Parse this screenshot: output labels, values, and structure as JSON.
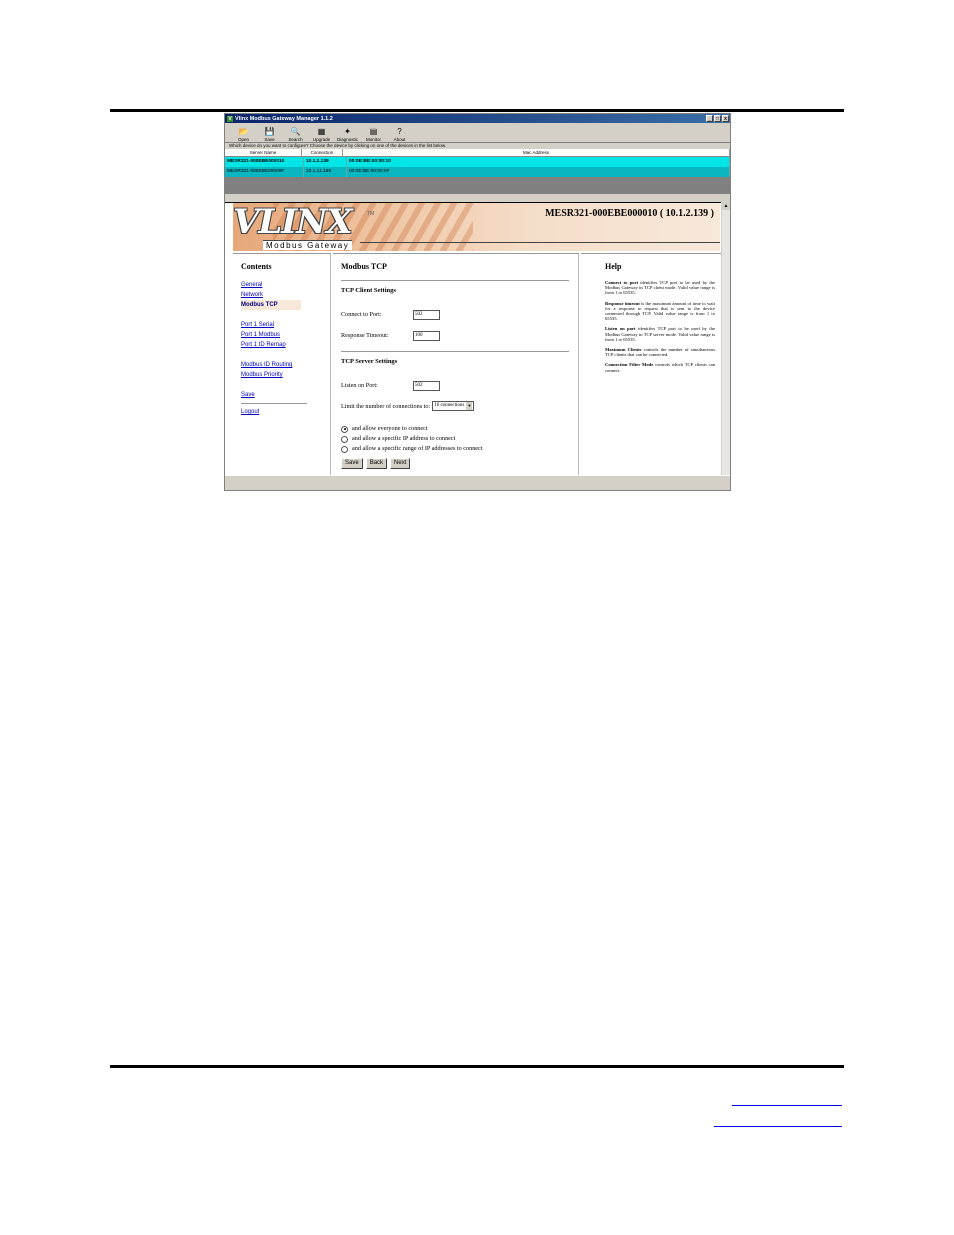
{
  "window": {
    "title": "Vlinx Modbus Gateway Manager 1.1.2",
    "controls": [
      "_",
      "□",
      "x"
    ]
  },
  "toolbar": [
    {
      "label": "Open",
      "icon": "open-folder-icon",
      "glyph": "📂"
    },
    {
      "label": "Save",
      "icon": "save-disk-icon",
      "glyph": "💾"
    },
    {
      "label": "Search",
      "icon": "search-icon",
      "glyph": "🔍"
    },
    {
      "label": "Upgrade",
      "icon": "upgrade-icon",
      "glyph": "▦"
    },
    {
      "label": "Diagnostic",
      "icon": "diagnostic-icon",
      "glyph": "✦"
    },
    {
      "label": "Monitor",
      "icon": "monitor-icon",
      "glyph": "▤"
    },
    {
      "label": "About",
      "icon": "help-question-icon",
      "glyph": "?"
    }
  ],
  "device_prompt": "Which device do you want to configure? Choose the device by clicking on one of the devices in the list below.",
  "device_table": {
    "headers": [
      "Server Name",
      "Connection",
      "Mac Address"
    ],
    "rows": [
      {
        "name": "MESR321-000EBE000010",
        "connection": "10.1.2.139",
        "mac": "00:0E:BE:00:00:10",
        "selected": true
      },
      {
        "name": "MESR321-000EBE00000F",
        "connection": "10.1.11.199",
        "mac": "00:0E:BE:00:00:0F",
        "selected": false
      }
    ]
  },
  "banner": {
    "logo": "VLINX",
    "tm": "TM",
    "subtitle": "Modbus Gateway",
    "device_title": "MESR321-000EBE000010 ( 10.1.2.139 )"
  },
  "contents": {
    "heading": "Contents",
    "groups": [
      [
        "General",
        "Network",
        "Modbus TCP"
      ],
      [
        "Port 1 Serial",
        "Port 1 Modbus",
        "Port 1 ID Remap"
      ],
      [
        "Modbus ID Routing",
        "Modbus Priority"
      ],
      [
        "Save"
      ],
      [
        "Logout"
      ]
    ],
    "active": "Modbus TCP"
  },
  "main": {
    "heading": "Modbus TCP",
    "client_heading": "TCP Client Settings",
    "connect_label": "Connect to Port:",
    "connect_value": "502",
    "timeout_label": "Response Timeout:",
    "timeout_value": "100",
    "server_heading": "TCP Server Settings",
    "listen_label": "Listen on Port:",
    "listen_value": "502",
    "limit_label": "Limit the number of connections to:",
    "limit_value": "16 connections",
    "radios": [
      {
        "label": "and allow everyone to connect",
        "checked": true
      },
      {
        "label": "and allow a specific IP address to connect",
        "checked": false
      },
      {
        "label": "and allow a specific range of IP addresses to connect",
        "checked": false
      }
    ],
    "buttons": [
      "Save",
      "Back",
      "Next"
    ]
  },
  "help": {
    "heading": "Help",
    "items": [
      {
        "term": "Connect to port",
        "text": " identifies TCP port to be used by the Modbus Gateway in TCP client mode. Valid value range is from 1 to 65535."
      },
      {
        "term": "Response timeout",
        "text": " is the maximum amount of time to wait for a response to request that is sent to the device connected through TCP. Valid value range is from 1 to 65535."
      },
      {
        "term": "Listen on port",
        "text": " identifies TCP port to be used by the Modbus Gateway in TCP server mode. Valid value range is from 1 to 65535."
      },
      {
        "term": "Maximum Clients",
        "text": " controls the number of simultaneous TCP clients that can be connected."
      },
      {
        "term": "Connection Filter Mode",
        "text": " controls which TCP clients can connect."
      }
    ]
  },
  "colors": {
    "selected_row": "#00e6e6",
    "other_row": "#0ab6c0",
    "titlebar": "#0a246a",
    "link": "#0000cc"
  }
}
